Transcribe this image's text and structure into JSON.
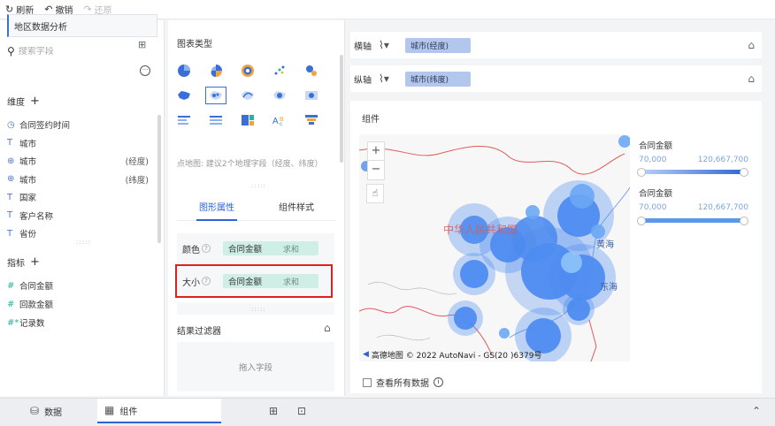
{
  "toolbar": {
    "refresh": "刷新",
    "undo": "撤销",
    "redo": "还原"
  },
  "left": {
    "dataset_name": "地区数据分析",
    "search_placeholder": "搜索字段",
    "dimension_title": "维度",
    "dimensions": [
      {
        "type": "time",
        "name": "合同签约时间",
        "sub": ""
      },
      {
        "type": "text",
        "name": "城市",
        "sub": ""
      },
      {
        "type": "geo",
        "name": "城市",
        "sub": "(经度)"
      },
      {
        "type": "geo",
        "name": "城市",
        "sub": "(纬度)"
      },
      {
        "type": "text",
        "name": "国家",
        "sub": ""
      },
      {
        "type": "text",
        "name": "客户名称",
        "sub": ""
      },
      {
        "type": "text",
        "name": "省份",
        "sub": ""
      }
    ],
    "measure_title": "指标",
    "measures": [
      {
        "name": "合同金额"
      },
      {
        "name": "回款金额"
      },
      {
        "name": "记录数"
      }
    ]
  },
  "middle": {
    "chart_type_title": "图表类型",
    "hint": "点地图: 建议2个地理字段（经度、纬度）",
    "tabs": [
      "图形属性",
      "组件样式"
    ],
    "props": [
      {
        "label": "颜色",
        "field": "合同金额",
        "agg": "求和"
      },
      {
        "label": "大小",
        "field": "合同金额",
        "agg": "求和"
      }
    ],
    "filter_title": "结果过滤器",
    "filter_placeholder": "拖入字段"
  },
  "axes": {
    "x_label": "横轴",
    "x_field": "城市(经度)",
    "y_label": "纵轴",
    "y_field": "城市(纬度)"
  },
  "component": {
    "title": "组件",
    "map_text": "中华人民共和国",
    "sea1": "黄海",
    "sea2": "东海",
    "attribution": "高德地图 © 2022 AutoNavi - GS(20",
    "attribution_tail": ")6379号",
    "legend": [
      {
        "title": "合同金额",
        "min": "70,000",
        "max": "120,667,700"
      },
      {
        "title": "合同金额",
        "min": "70,000",
        "max": "120,667,700"
      }
    ],
    "show_all": "查看所有数据"
  },
  "bottom": {
    "data_tab": "数据",
    "component_tab": "组件"
  },
  "colors": {
    "accent": "#2f63d3",
    "highlight_border": "#e0211b",
    "bubble": "#4e8cf0"
  }
}
